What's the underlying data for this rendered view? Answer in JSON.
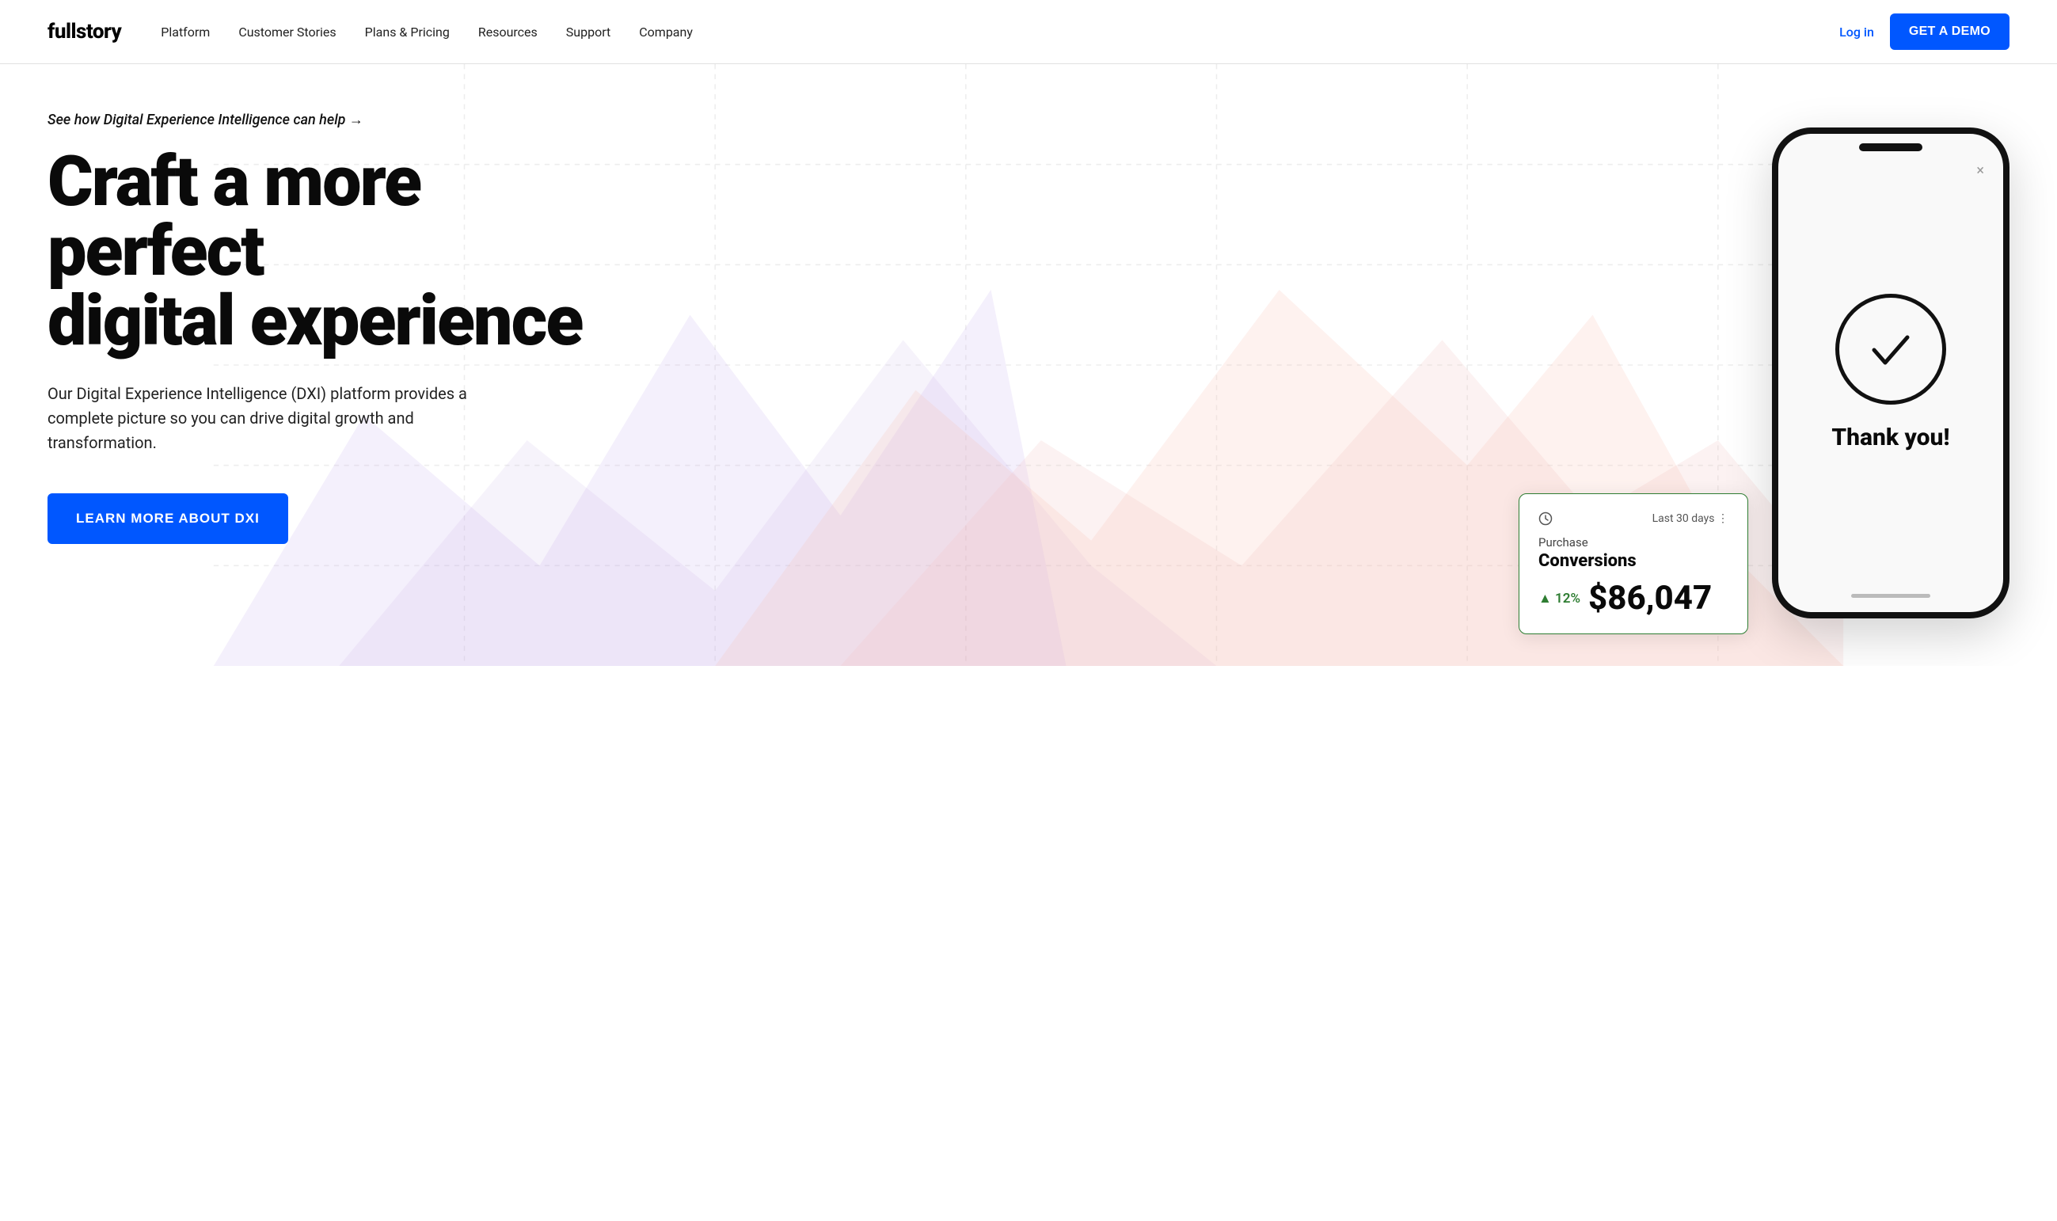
{
  "brand": {
    "logo": "fullstory"
  },
  "navbar": {
    "links": [
      {
        "id": "platform",
        "label": "Platform"
      },
      {
        "id": "customer-stories",
        "label": "Customer Stories"
      },
      {
        "id": "plans-pricing",
        "label": "Plans & Pricing"
      },
      {
        "id": "resources",
        "label": "Resources"
      },
      {
        "id": "support",
        "label": "Support"
      },
      {
        "id": "company",
        "label": "Company"
      }
    ],
    "login_label": "Log in",
    "demo_label": "GET A DEMO"
  },
  "hero": {
    "tag": "See how Digital Experience Intelligence can help →",
    "headline_line1": "Craft a more perfect",
    "headline_line2": "digital experience",
    "subtext": "Our Digital Experience Intelligence (DXI) platform provides a complete picture so you can drive digital growth and transformation.",
    "cta_label": "LEARN MORE ABOUT DXI"
  },
  "phone": {
    "close_symbol": "×",
    "check_symbol": "✓",
    "thank_you": "Thank you!"
  },
  "conversion_card": {
    "period": "Last 30 days ⋮",
    "label": "Purchase",
    "metric": "Conversions",
    "pct_change": "▲ 12%",
    "value": "$86,047"
  }
}
